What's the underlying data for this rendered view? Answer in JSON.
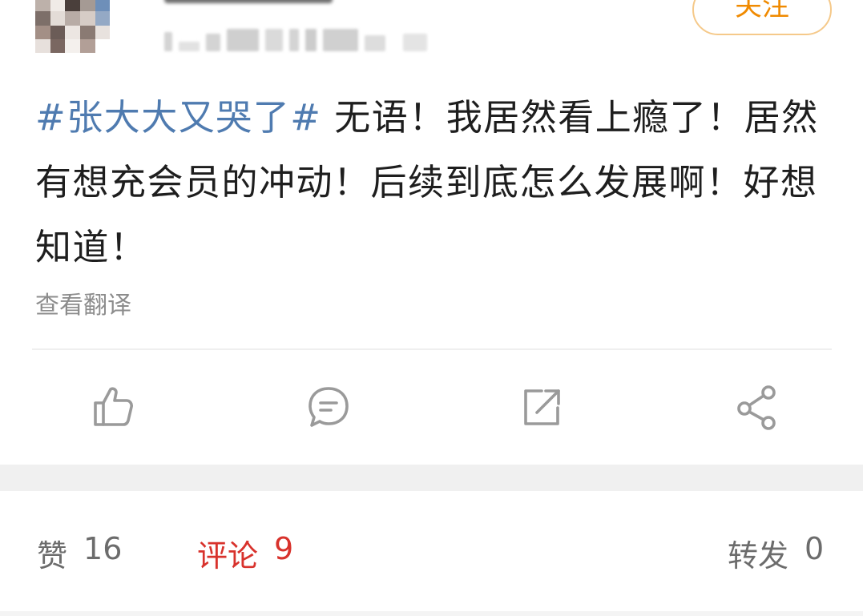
{
  "header": {
    "follow_label": "关注"
  },
  "post": {
    "hashtag": "#张大大又哭了#",
    "text": " 无语！我居然看上瘾了！居然有想充会员的冲动！后续到底怎么发展啊！好想知道！",
    "translate_label": "查看翻译"
  },
  "actions": [
    {
      "name": "like",
      "icon": "thumbs-up-icon"
    },
    {
      "name": "comment",
      "icon": "comment-bubble-icon"
    },
    {
      "name": "repost",
      "icon": "repost-arrow-icon"
    },
    {
      "name": "share",
      "icon": "share-nodes-icon"
    }
  ],
  "stats": {
    "likes_label": "赞",
    "likes_count": "16",
    "comments_label": "评论",
    "comments_count": "9",
    "reposts_label": "转发",
    "reposts_count": "0"
  },
  "colors": {
    "hashtag": "#4f7bb0",
    "follow_accent": "#f08a00",
    "active_tab": "#d8322c",
    "muted_text": "#8c8c8c"
  }
}
